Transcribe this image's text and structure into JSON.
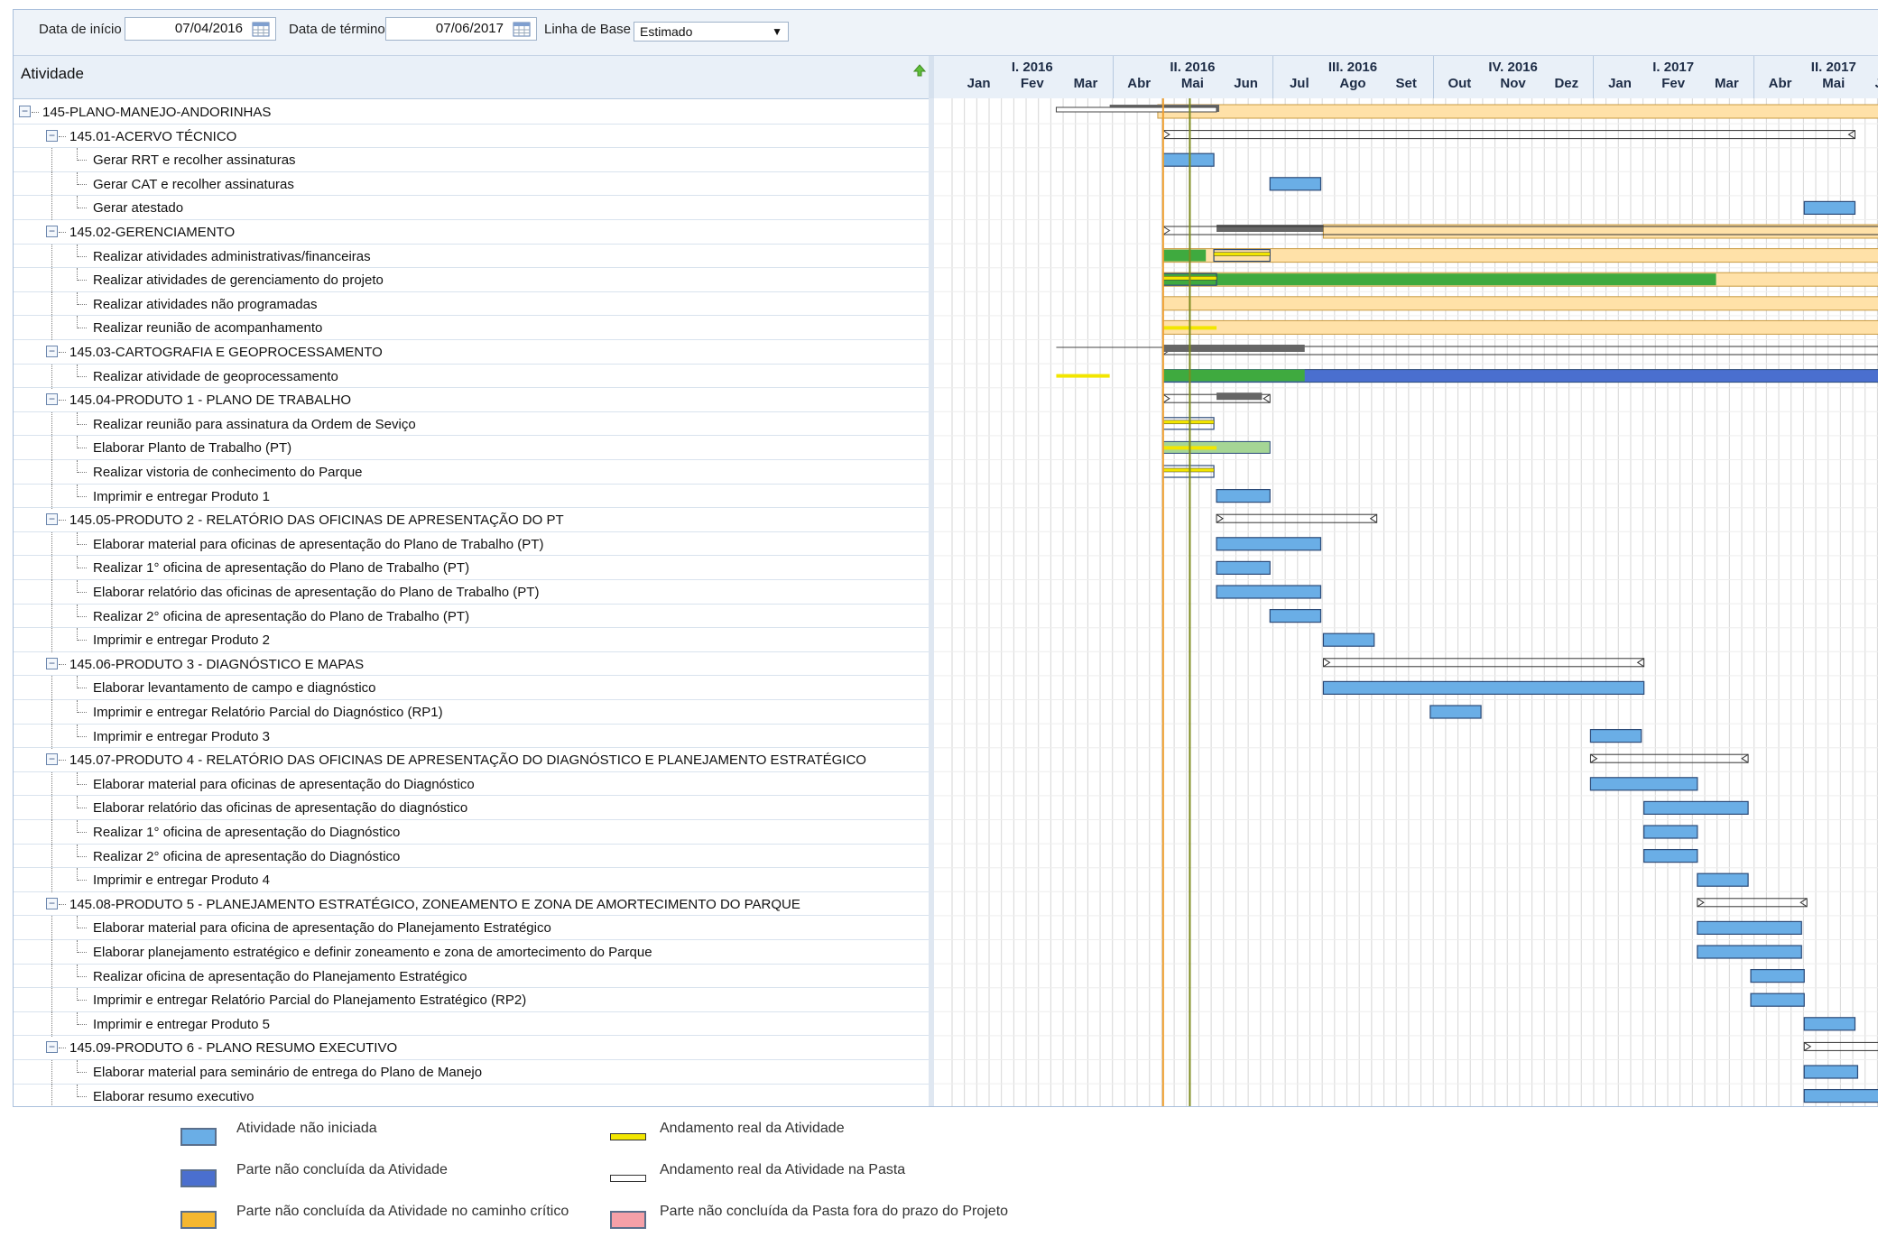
{
  "toolbar": {
    "start_label": "Data de início",
    "start_value": "07/04/2016",
    "end_label": "Data de término",
    "end_value": "07/06/2017",
    "baseline_label": "Linha de Base",
    "baseline_value": "Estimado"
  },
  "grid": {
    "column_title": "Atividade"
  },
  "timeline": {
    "quarters": [
      "I. 2016",
      "II. 2016",
      "III. 2016",
      "IV. 2016",
      "I. 2017",
      "II. 2017"
    ],
    "months": [
      "Jan",
      "Fev",
      "Mar",
      "Abr",
      "Mai",
      "Jun",
      "Jul",
      "Ago",
      "Set",
      "Out",
      "Nov",
      "Dez",
      "Jan",
      "Fev",
      "Mar",
      "Abr",
      "Mai",
      "Jun"
    ]
  },
  "rows": [
    {
      "label": "145-PLANO-MANEJO-ANDORINHAS",
      "level": 0,
      "group": true
    },
    {
      "label": "145.01-ACERVO TÉCNICO",
      "level": 1,
      "group": true
    },
    {
      "label": "Gerar RRT e recolher assinaturas",
      "level": 2,
      "group": false
    },
    {
      "label": "Gerar CAT e recolher assinaturas",
      "level": 2,
      "group": false
    },
    {
      "label": "Gerar atestado",
      "level": 2,
      "group": false
    },
    {
      "label": "145.02-GERENCIAMENTO",
      "level": 1,
      "group": true
    },
    {
      "label": "Realizar atividades administrativas/financeiras",
      "level": 2,
      "group": false
    },
    {
      "label": "Realizar atividades de gerenciamento do projeto",
      "level": 2,
      "group": false
    },
    {
      "label": "Realizar atividades não programadas",
      "level": 2,
      "group": false
    },
    {
      "label": "Realizar reunião de acompanhamento",
      "level": 2,
      "group": false
    },
    {
      "label": "145.03-CARTOGRAFIA E GEOPROCESSAMENTO",
      "level": 1,
      "group": true
    },
    {
      "label": "Realizar atividade de geoprocessamento",
      "level": 2,
      "group": false
    },
    {
      "label": "145.04-PRODUTO 1 - PLANO DE TRABALHO",
      "level": 1,
      "group": true
    },
    {
      "label": "Realizar reunião para assinatura da Ordem de Seviço",
      "level": 2,
      "group": false
    },
    {
      "label": "Elaborar Planto de Trabalho (PT)",
      "level": 2,
      "group": false
    },
    {
      "label": "Realizar vistoria de conhecimento do Parque",
      "level": 2,
      "group": false
    },
    {
      "label": "Imprimir e entregar Produto 1",
      "level": 2,
      "group": false
    },
    {
      "label": "145.05-PRODUTO 2 - RELATÓRIO DAS OFICINAS DE APRESENTAÇÃO DO PT",
      "level": 1,
      "group": true
    },
    {
      "label": "Elaborar material para oficinas de apresentação do Plano de Trabalho (PT)",
      "level": 2,
      "group": false
    },
    {
      "label": "Realizar 1° oficina de apresentação do Plano de Trabalho (PT)",
      "level": 2,
      "group": false
    },
    {
      "label": "Elaborar relatório das oficinas de apresentação do Plano de Trabalho (PT)",
      "level": 2,
      "group": false
    },
    {
      "label": "Realizar 2° oficina de apresentação do Plano de Trabalho (PT)",
      "level": 2,
      "group": false
    },
    {
      "label": "Imprimir e entregar Produto 2",
      "level": 2,
      "group": false
    },
    {
      "label": "145.06-PRODUTO 3 - DIAGNÓSTICO E MAPAS",
      "level": 1,
      "group": true
    },
    {
      "label": "Elaborar levantamento de campo e diagnóstico",
      "level": 2,
      "group": false
    },
    {
      "label": "Imprimir e entregar Relatório Parcial do Diagnóstico (RP1)",
      "level": 2,
      "group": false
    },
    {
      "label": "Imprimir e entregar Produto 3",
      "level": 2,
      "group": false
    },
    {
      "label": "145.07-PRODUTO 4 - RELATÓRIO DAS OFICINAS DE APRESENTAÇÃO DO DIAGNÓSTICO E PLANEJAMENTO ESTRATÉGICO",
      "level": 1,
      "group": true
    },
    {
      "label": "Elaborar material para oficinas de apresentação do Diagnóstico",
      "level": 2,
      "group": false
    },
    {
      "label": "Elaborar relatório das oficinas de apresentação do diagnóstico",
      "level": 2,
      "group": false
    },
    {
      "label": "Realizar 1° oficina de apresentação do Diagnóstico",
      "level": 2,
      "group": false
    },
    {
      "label": "Realizar 2° oficina de apresentação do Diagnóstico",
      "level": 2,
      "group": false
    },
    {
      "label": "Imprimir e entregar Produto 4",
      "level": 2,
      "group": false
    },
    {
      "label": "145.08-PRODUTO 5 - PLANEJAMENTO ESTRATÉGICO, ZONEAMENTO E ZONA DE AMORTECIMENTO DO PARQUE",
      "level": 1,
      "group": true
    },
    {
      "label": "Elaborar material para oficina de apresentação do Planejamento Estratégico",
      "level": 2,
      "group": false
    },
    {
      "label": "Elaborar planejamento estratégico e definir zoneamento e zona de amortecimento do Parque",
      "level": 2,
      "group": false
    },
    {
      "label": "Realizar oficina de apresentação do Planejamento Estratégico",
      "level": 2,
      "group": false
    },
    {
      "label": "Imprimir e entregar Relatório Parcial do Planejamento Estratégico (RP2)",
      "level": 2,
      "group": false
    },
    {
      "label": "Imprimir e entregar Produto 5",
      "level": 2,
      "group": false
    },
    {
      "label": "145.09-PRODUTO 6 - PLANO RESUMO EXECUTIVO",
      "level": 1,
      "group": true
    },
    {
      "label": "Elaborar material para seminário de entrega do Plano de Manejo",
      "level": 2,
      "group": false
    },
    {
      "label": "Elaborar resumo executivo",
      "level": 2,
      "group": false
    }
  ],
  "bars": [
    {
      "row": 0,
      "type": "orange",
      "start": 3.85,
      "end": 18
    },
    {
      "row": 0,
      "type": "darkgray",
      "start": 2.95,
      "end": 5.0
    },
    {
      "row": 0,
      "type": "outline",
      "start": 1.95,
      "end": 4.95
    },
    {
      "row": 1,
      "type": "summary",
      "start": 3.95,
      "end": 16.9
    },
    {
      "row": 2,
      "type": "blue",
      "start": 3.95,
      "end": 4.9
    },
    {
      "row": 3,
      "type": "blue",
      "start": 5.95,
      "end": 6.9
    },
    {
      "row": 4,
      "type": "blue",
      "start": 15.95,
      "end": 16.9
    },
    {
      "row": 5,
      "type": "orange",
      "start": 6.95,
      "end": 18
    },
    {
      "row": 5,
      "type": "darkgray",
      "start": 4.95,
      "end": 6.95
    },
    {
      "row": 5,
      "type": "summary",
      "start": 3.95,
      "end": 18
    },
    {
      "row": 6,
      "type": "orange",
      "start": 3.95,
      "end": 18
    },
    {
      "row": 6,
      "type": "green",
      "start": 3.95,
      "end": 4.75
    },
    {
      "row": 6,
      "type": "yellow-outline",
      "start": 4.9,
      "end": 5.95
    },
    {
      "row": 7,
      "type": "orange",
      "start": 3.95,
      "end": 18
    },
    {
      "row": 7,
      "type": "green",
      "start": 3.95,
      "end": 14.3
    },
    {
      "row": 7,
      "type": "yellow-outline",
      "start": 3.95,
      "end": 4.95
    },
    {
      "row": 8,
      "type": "orange",
      "start": 3.95,
      "end": 18
    },
    {
      "row": 9,
      "type": "orange",
      "start": 3.95,
      "end": 18
    },
    {
      "row": 9,
      "type": "yellow-line",
      "start": 3.95,
      "end": 4.95
    },
    {
      "row": 10,
      "type": "summary",
      "start": 3.95,
      "end": 18
    },
    {
      "row": 10,
      "type": "darkgray",
      "start": 3.95,
      "end": 6.6
    },
    {
      "row": 10,
      "type": "thin-line",
      "start": 1.95,
      "end": 3.95
    },
    {
      "row": 11,
      "type": "navy",
      "start": 3.95,
      "end": 18
    },
    {
      "row": 11,
      "type": "green",
      "start": 3.95,
      "end": 6.6
    },
    {
      "row": 11,
      "type": "yellow-line",
      "start": 1.95,
      "end": 2.95
    },
    {
      "row": 12,
      "type": "summary",
      "start": 3.95,
      "end": 5.95
    },
    {
      "row": 12,
      "type": "darkgray",
      "start": 4.95,
      "end": 5.8
    },
    {
      "row": 13,
      "type": "yellow-outline",
      "start": 3.95,
      "end": 4.9
    },
    {
      "row": 14,
      "type": "lightgreen",
      "start": 3.95,
      "end": 5.95
    },
    {
      "row": 14,
      "type": "yellow-line",
      "start": 3.95,
      "end": 4.95
    },
    {
      "row": 15,
      "type": "yellow-outline",
      "start": 3.95,
      "end": 4.9
    },
    {
      "row": 16,
      "type": "blue",
      "start": 4.95,
      "end": 5.95
    },
    {
      "row": 17,
      "type": "summary",
      "start": 4.95,
      "end": 7.95
    },
    {
      "row": 18,
      "type": "blue",
      "start": 4.95,
      "end": 6.9
    },
    {
      "row": 19,
      "type": "blue",
      "start": 4.95,
      "end": 5.95
    },
    {
      "row": 20,
      "type": "blue",
      "start": 4.95,
      "end": 6.9
    },
    {
      "row": 21,
      "type": "blue",
      "start": 5.95,
      "end": 6.9
    },
    {
      "row": 22,
      "type": "blue",
      "start": 6.95,
      "end": 7.9
    },
    {
      "row": 23,
      "type": "summary",
      "start": 6.95,
      "end": 12.95
    },
    {
      "row": 24,
      "type": "blue",
      "start": 6.95,
      "end": 12.95
    },
    {
      "row": 25,
      "type": "blue",
      "start": 8.95,
      "end": 9.9
    },
    {
      "row": 26,
      "type": "blue",
      "start": 11.95,
      "end": 12.9
    },
    {
      "row": 27,
      "type": "summary",
      "start": 11.95,
      "end": 14.9
    },
    {
      "row": 28,
      "type": "blue",
      "start": 11.95,
      "end": 13.95
    },
    {
      "row": 29,
      "type": "blue",
      "start": 12.95,
      "end": 14.9
    },
    {
      "row": 30,
      "type": "blue",
      "start": 12.95,
      "end": 13.95
    },
    {
      "row": 31,
      "type": "blue",
      "start": 12.95,
      "end": 13.95
    },
    {
      "row": 32,
      "type": "blue",
      "start": 13.95,
      "end": 14.9
    },
    {
      "row": 33,
      "type": "summary",
      "start": 13.95,
      "end": 16.0
    },
    {
      "row": 34,
      "type": "blue",
      "start": 13.95,
      "end": 15.9
    },
    {
      "row": 35,
      "type": "blue",
      "start": 13.95,
      "end": 15.9
    },
    {
      "row": 36,
      "type": "blue",
      "start": 14.95,
      "end": 15.95
    },
    {
      "row": 37,
      "type": "blue",
      "start": 14.95,
      "end": 15.95
    },
    {
      "row": 38,
      "type": "blue",
      "start": 15.95,
      "end": 16.9
    },
    {
      "row": 39,
      "type": "summary",
      "start": 15.95,
      "end": 17.95
    },
    {
      "row": 40,
      "type": "blue",
      "start": 15.95,
      "end": 16.95
    },
    {
      "row": 41,
      "type": "blue",
      "start": 15.95,
      "end": 17.95
    }
  ],
  "markers": {
    "orange_line_month": 3.95,
    "olive_line_month": 4.45,
    "orange_color": "#f0a030",
    "olive_color": "#7d8a1f"
  },
  "colors": {
    "blue": "#6aaee6",
    "navy": "#4a6fcf",
    "orange": "#ffe1a8",
    "green": "#3faa3f",
    "lightgreen": "#a5d595",
    "yellow": "#f2e600",
    "darkgray": "#666666",
    "critical": "#f5b730",
    "late": "#f5a0a8"
  },
  "legend": [
    {
      "label": "Atividade não iniciada",
      "swatch": "blue"
    },
    {
      "label": "Andamento real da Atividade",
      "swatch": "yellow-line"
    },
    {
      "label": "Parte não concluída da Atividade",
      "swatch": "navy"
    },
    {
      "label": "Andamento real da Atividade na Pasta",
      "swatch": "white-line"
    },
    {
      "label": "Parte não concluída da Atividade no caminho crítico",
      "swatch": "critical"
    },
    {
      "label": "Parte não concluída da Pasta fora do prazo do Projeto",
      "swatch": "late"
    }
  ]
}
